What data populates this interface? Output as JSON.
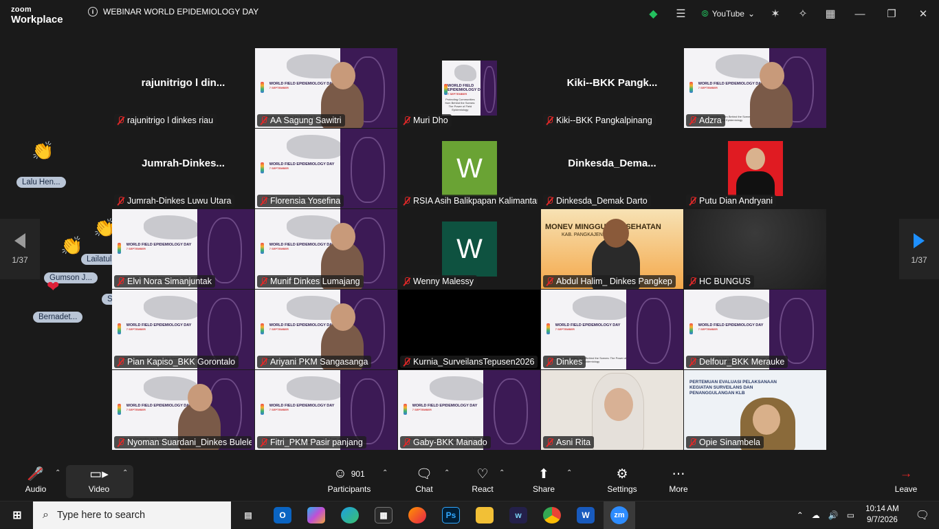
{
  "app": {
    "brand_line1": "zoom",
    "brand_line2": "Workplace",
    "meeting_title": "WEBINAR WORLD EPIDEMIOLOGY DAY",
    "stream_label": "YouTube"
  },
  "pager": {
    "left": "1/37",
    "right": "1/37"
  },
  "tiles": [
    {
      "label": "rajunitrigo l dinkes riau",
      "big": "rajunitrigo  l  din...",
      "kind": "name"
    },
    {
      "label": "AA Sagung Sawitri",
      "kind": "slide-person"
    },
    {
      "label": "Muri Dho",
      "kind": "small-slide"
    },
    {
      "label": "Kiki--BKK Pangkalpinang",
      "big": "Kiki--BKK  Pangk...",
      "kind": "name"
    },
    {
      "label": "Adzra",
      "kind": "slide-person",
      "active": true
    },
    {
      "label": "Jumrah-Dinkes Luwu Utara",
      "big": "Jumrah-Dinkes...",
      "kind": "name"
    },
    {
      "label": "Florensia Yosefina",
      "kind": "slide"
    },
    {
      "label": "RSIA Asih Balikpapan Kalimantan Timur",
      "avatar": "W",
      "avatar_color": "#6aa334",
      "kind": "avatar"
    },
    {
      "label": "Dinkesda_Demak Darto",
      "big": "Dinkesda_Dema...",
      "kind": "name"
    },
    {
      "label": "Putu Dian Andryani",
      "kind": "portrait"
    },
    {
      "label": "Elvi Nora Simanjuntak",
      "kind": "slide"
    },
    {
      "label": "Munif Dinkes Lumajang",
      "kind": "slide-person"
    },
    {
      "label": "Wenny Malessy",
      "avatar": "W",
      "avatar_color": "#0e5240",
      "kind": "avatar"
    },
    {
      "label": "Abdul Halim_ Dinkes Pangkep",
      "banner": "MONEV MINGGU        S KESEHATAN",
      "banner_sub": "KAB. PANGKAJENE DA",
      "kind": "banner"
    },
    {
      "label": "HC BUNGUS",
      "kind": "dark"
    },
    {
      "label": "Pian Kapiso_BKK Gorontalo",
      "kind": "slide"
    },
    {
      "label": "Ariyani PKM Sangasanga",
      "kind": "slide-person"
    },
    {
      "label": "Kurnia_SurveilansTepusen2026",
      "kind": "black"
    },
    {
      "label": "Dinkes",
      "kind": "slide"
    },
    {
      "label": "Delfour_BKK Merauke",
      "kind": "slide"
    },
    {
      "label": "Nyoman Suardani_Dinkes Buleleng",
      "kind": "slide-person"
    },
    {
      "label": "Fitri_PKM Pasir panjang",
      "kind": "slide"
    },
    {
      "label": "Gaby-BKK Manado",
      "kind": "slide"
    },
    {
      "label": "Asni Rita",
      "kind": "camera"
    },
    {
      "label": "Opie Sinambela",
      "banner": "PERTEMUAN EVALUASI PELAKSANAAN KEGIATAN SURVEILANS DAN PENANGGULANGAN KLB",
      "kind": "camera-banner"
    }
  ],
  "slide_text": {
    "title": "WORLD FIELD EPIDEMIOLOGY DAY",
    "date": "7 SEPTEMBER",
    "foot": "Protecting Communities from Behind the Scenes: The Power of Field Epidemiology"
  },
  "reactions": {
    "p1": "Lalu  Hen...",
    "p2": "Lailatul  K...",
    "p3": "Gumson  J...",
    "p4": "S Firman",
    "p5": "Bernadet..."
  },
  "toolbar": {
    "audio": "Audio",
    "video": "Video",
    "participants": "Participants",
    "participants_count": "901",
    "chat": "Chat",
    "react": "React",
    "share": "Share",
    "settings": "Settings",
    "more": "More",
    "leave": "Leave"
  },
  "taskbar": {
    "search_placeholder": "Type here to search",
    "time": "10:14 AM",
    "date": "9/7/2026"
  }
}
